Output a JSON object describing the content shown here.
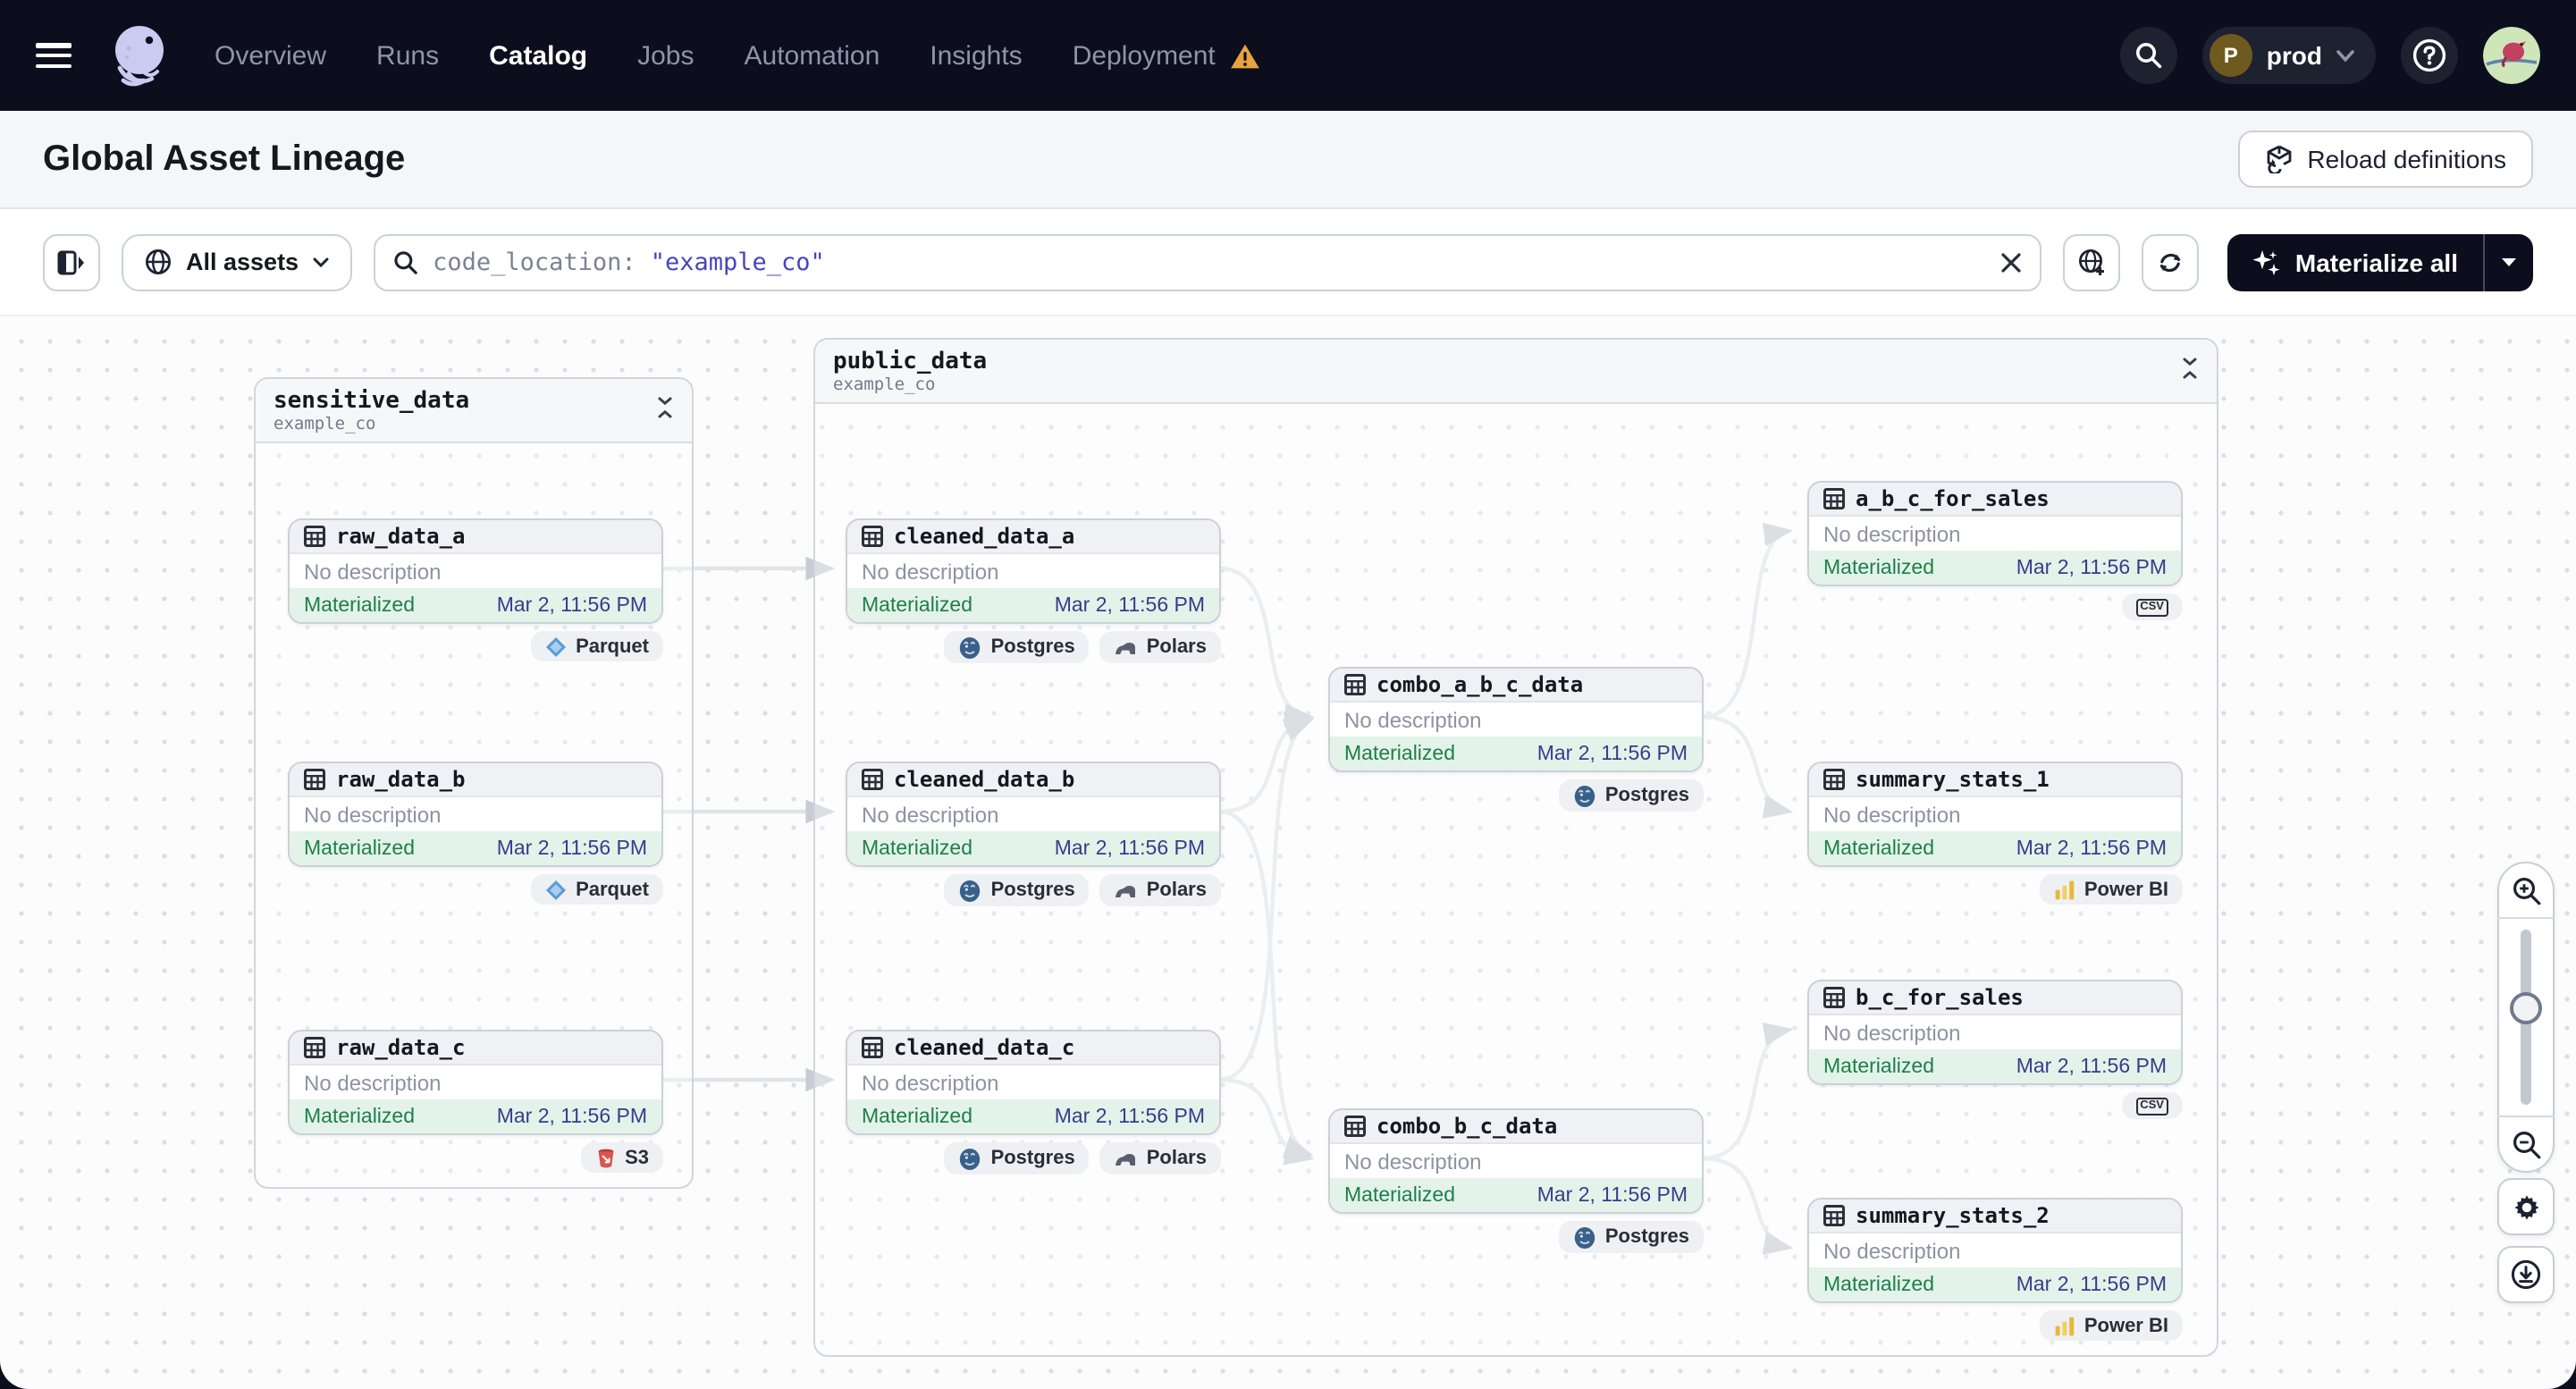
{
  "nav": {
    "items": [
      {
        "label": "Overview"
      },
      {
        "label": "Runs"
      },
      {
        "label": "Catalog"
      },
      {
        "label": "Jobs"
      },
      {
        "label": "Automation"
      },
      {
        "label": "Insights"
      },
      {
        "label": "Deployment"
      }
    ],
    "active_item": "Catalog",
    "deployment": {
      "initial": "P",
      "name": "prod"
    }
  },
  "page": {
    "title": "Global Asset Lineage",
    "reload_button_label": "Reload definitions"
  },
  "toolbar": {
    "filter_label": "All assets",
    "search_prefix": "code_location:",
    "search_value": "\"example_co\"",
    "materialize_button_label": "Materialize all"
  },
  "graph": {
    "groups": [
      {
        "name": "sensitive_data",
        "code_location": "example_co"
      },
      {
        "name": "public_data",
        "code_location": "example_co"
      }
    ],
    "nodes": [
      {
        "name": "raw_data_a",
        "description": "No description",
        "status": "Materialized",
        "timestamp": "Mar 2, 11:56 PM",
        "tags": [
          {
            "icon": "parquet-icon",
            "label": "Parquet"
          }
        ]
      },
      {
        "name": "raw_data_b",
        "description": "No description",
        "status": "Materialized",
        "timestamp": "Mar 2, 11:56 PM",
        "tags": [
          {
            "icon": "parquet-icon",
            "label": "Parquet"
          }
        ]
      },
      {
        "name": "raw_data_c",
        "description": "No description",
        "status": "Materialized",
        "timestamp": "Mar 2, 11:56 PM",
        "tags": [
          {
            "icon": "s3-icon",
            "label": "S3"
          }
        ]
      },
      {
        "name": "cleaned_data_a",
        "description": "No description",
        "status": "Materialized",
        "timestamp": "Mar 2, 11:56 PM",
        "tags": [
          {
            "icon": "postgres-icon",
            "label": "Postgres"
          },
          {
            "icon": "polars-icon",
            "label": "Polars"
          }
        ]
      },
      {
        "name": "cleaned_data_b",
        "description": "No description",
        "status": "Materialized",
        "timestamp": "Mar 2, 11:56 PM",
        "tags": [
          {
            "icon": "postgres-icon",
            "label": "Postgres"
          },
          {
            "icon": "polars-icon",
            "label": "Polars"
          }
        ]
      },
      {
        "name": "cleaned_data_c",
        "description": "No description",
        "status": "Materialized",
        "timestamp": "Mar 2, 11:56 PM",
        "tags": [
          {
            "icon": "postgres-icon",
            "label": "Postgres"
          },
          {
            "icon": "polars-icon",
            "label": "Polars"
          }
        ]
      },
      {
        "name": "combo_a_b_c_data",
        "description": "No description",
        "status": "Materialized",
        "timestamp": "Mar 2, 11:56 PM",
        "tags": [
          {
            "icon": "postgres-icon",
            "label": "Postgres"
          }
        ]
      },
      {
        "name": "combo_b_c_data",
        "description": "No description",
        "status": "Materialized",
        "timestamp": "Mar 2, 11:56 PM",
        "tags": [
          {
            "icon": "postgres-icon",
            "label": "Postgres"
          }
        ]
      },
      {
        "name": "a_b_c_for_sales",
        "description": "No description",
        "status": "Materialized",
        "timestamp": "Mar 2, 11:56 PM",
        "tags": [
          {
            "icon": "csv-icon",
            "label": "CSV"
          }
        ]
      },
      {
        "name": "summary_stats_1",
        "description": "No description",
        "status": "Materialized",
        "timestamp": "Mar 2, 11:56 PM",
        "tags": [
          {
            "icon": "powerbi-icon",
            "label": "Power BI"
          }
        ]
      },
      {
        "name": "b_c_for_sales",
        "description": "No description",
        "status": "Materialized",
        "timestamp": "Mar 2, 11:56 PM",
        "tags": [
          {
            "icon": "csv-icon",
            "label": "CSV"
          }
        ]
      },
      {
        "name": "summary_stats_2",
        "description": "No description",
        "status": "Materialized",
        "timestamp": "Mar 2, 11:56 PM",
        "tags": [
          {
            "icon": "powerbi-icon",
            "label": "Power BI"
          }
        ]
      }
    ]
  }
}
